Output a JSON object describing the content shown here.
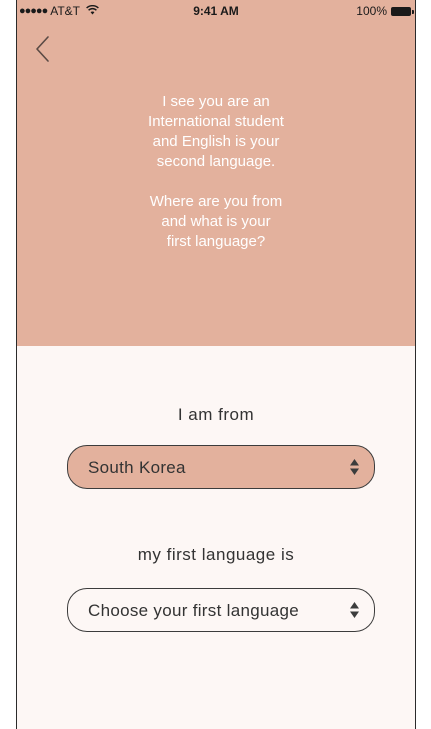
{
  "status_bar": {
    "signal": "●●●●●",
    "carrier": "AT&T",
    "time": "9:41 AM",
    "battery": "100%"
  },
  "intro": {
    "lines": [
      "I see you are an",
      "International student",
      "and English is your",
      "second language."
    ],
    "question_lines": [
      "Where are you from",
      "and what is your",
      "first language?"
    ]
  },
  "form": {
    "country_label": "I am from",
    "country_value": "South Korea",
    "language_label": "my first language is",
    "language_placeholder": "Choose your first language"
  },
  "colors": {
    "header_bg": "#e3b19d",
    "page_bg": "#fdf7f5",
    "text": "#333333"
  },
  "icons": {
    "back": "chevron-left-icon",
    "select": "up-down-arrows-icon",
    "wifi": "wifi-icon",
    "battery": "battery-icon"
  }
}
